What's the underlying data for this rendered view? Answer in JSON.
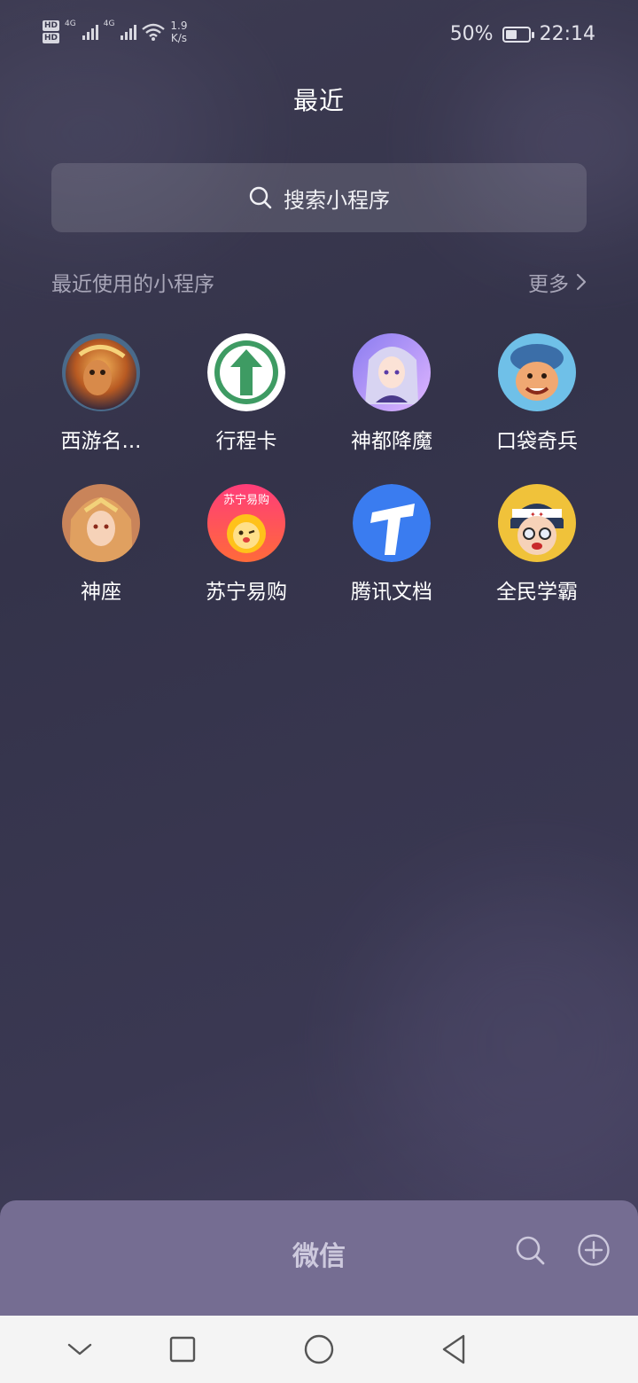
{
  "status_bar": {
    "hd1": "HD",
    "hd2": "HD",
    "net1": "4G",
    "net2": "4G",
    "speed_value": "1.9",
    "speed_unit": "K/s",
    "battery_text": "50%",
    "battery_level": 0.5,
    "time": "22:14"
  },
  "page": {
    "title": "最近"
  },
  "search": {
    "placeholder": "搜索小程序",
    "icon": "search-icon"
  },
  "section": {
    "title": "最近使用的小程序",
    "more_label": "更多",
    "more_icon": "chevron-right-icon"
  },
  "apps": [
    {
      "label": "西游名...",
      "icon": "monkey-king-avatar-icon"
    },
    {
      "label": "行程卡",
      "icon": "green-up-arrow-icon"
    },
    {
      "label": "神都降魔",
      "icon": "anime-girl-avatar-icon"
    },
    {
      "label": "口袋奇兵",
      "icon": "soldier-avatar-icon"
    },
    {
      "label": "神座",
      "icon": "warrior-avatar-icon"
    },
    {
      "label": "苏宁易购",
      "icon": "suning-lion-icon",
      "badge": "苏宁易购"
    },
    {
      "label": "腾讯文档",
      "icon": "tencent-docs-icon"
    },
    {
      "label": "全民学霸",
      "icon": "student-avatar-icon"
    }
  ],
  "bottom_bar": {
    "title": "微信",
    "search_icon": "search-icon",
    "add_icon": "plus-circle-icon"
  },
  "nav_bar": {
    "items": [
      "chevron-down-icon",
      "square-icon",
      "circle-icon",
      "triangle-back-icon"
    ]
  },
  "colors": {
    "background": "#36354b",
    "search_bg": "rgba(255,255,255,0.13)",
    "bottom_bar": "#756d92",
    "nav_bar": "#f4f4f4",
    "muted_text": "#a8a6b8"
  }
}
